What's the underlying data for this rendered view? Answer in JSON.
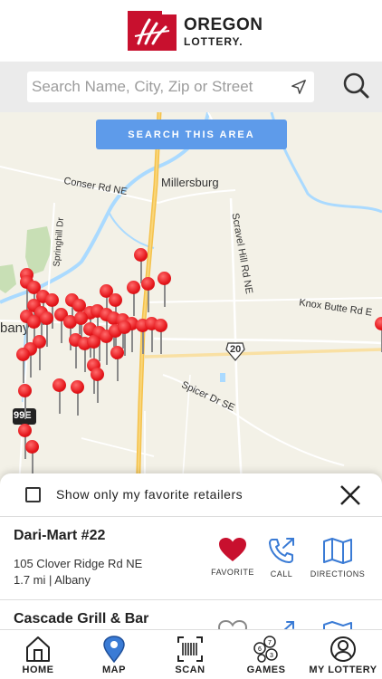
{
  "header": {
    "brand_line1": "OREGON",
    "brand_line2": "LOTTERY.",
    "brand_color": "#c8102e"
  },
  "search": {
    "placeholder": "Search Name, City, Zip or Street",
    "value": ""
  },
  "map": {
    "search_area_label": "SEARCH THIS AREA",
    "labels": {
      "millersburg": "Millersburg",
      "conser": "Conser Rd NE",
      "scravel": "Scravel Hill Rd NE",
      "knox": "Knox Butte Rd E",
      "spicer": "Spicer Dr SE",
      "springhill": "Springhill Dr",
      "albany": "bany",
      "hwy20": "20",
      "hwy99e": "99E"
    },
    "pin_color": "#e5161b",
    "water_color": "#aadaff",
    "park_color": "#c8dfb5"
  },
  "sheet": {
    "favorites_only_label": "Show only my favorite retailers",
    "favorites_only_checked": false,
    "retailers": [
      {
        "name": "Dari-Mart #22",
        "address": "105 Clover Ridge Rd NE",
        "meta": "1.7 mi | Albany",
        "favorite_label": "FAVORITE",
        "call_label": "CALL",
        "directions_label": "DIRECTIONS"
      },
      {
        "name": "Cascade Grill & Bar"
      }
    ],
    "heart_color": "#c8102e",
    "icon_blue": "#3a7bd5"
  },
  "tabs": [
    {
      "label": "HOME",
      "icon": "home-icon"
    },
    {
      "label": "MAP",
      "icon": "map-pin-icon"
    },
    {
      "label": "SCAN",
      "icon": "barcode-icon"
    },
    {
      "label": "GAMES",
      "icon": "lottery-balls-icon"
    },
    {
      "label": "MY LOTTERY",
      "icon": "user-icon"
    }
  ]
}
